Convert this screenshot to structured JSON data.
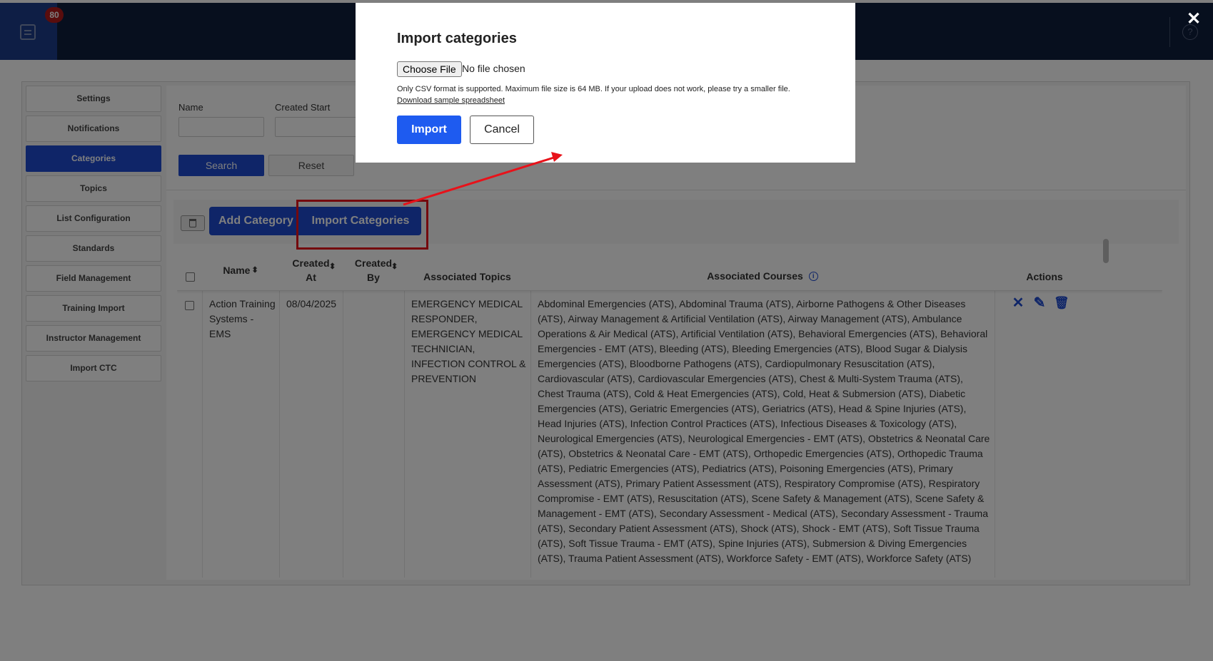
{
  "topbar": {
    "badge_count": "80",
    "help_icon": "question-circle-icon"
  },
  "sidebar": {
    "items": [
      {
        "label": "Settings",
        "active": false
      },
      {
        "label": "Notifications",
        "active": false
      },
      {
        "label": "Categories",
        "active": true
      },
      {
        "label": "Topics",
        "active": false
      },
      {
        "label": "List Configuration",
        "active": false
      },
      {
        "label": "Standards",
        "active": false
      },
      {
        "label": "Field Management",
        "active": false
      },
      {
        "label": "Training Import",
        "active": false
      },
      {
        "label": "Instructor Management",
        "active": false
      },
      {
        "label": "Import CTC",
        "active": false
      }
    ]
  },
  "filters": {
    "name_label": "Name",
    "created_start_label": "Created Start",
    "name_value": "",
    "created_start_value": "",
    "search_label": "Search",
    "reset_label": "Reset"
  },
  "toolbar": {
    "add_label": "Add Category",
    "import_label": "Import Categories"
  },
  "table": {
    "headers": {
      "name": "Name",
      "created_at": "Created At",
      "created_by": "Created By",
      "associated_topics": "Associated Topics",
      "associated_courses": "Associated Courses",
      "actions": "Actions"
    },
    "rows": [
      {
        "name": "Action Training Systems - EMS",
        "created_at": "08/04/2025",
        "created_by": "",
        "associated_topics": "EMERGENCY MEDICAL RESPONDER, EMERGENCY MEDICAL TECHNICIAN, INFECTION CONTROL & PREVENTION",
        "associated_courses": "Abdominal Emergencies (ATS), Abdominal Trauma (ATS), Airborne Pathogens & Other Diseases (ATS), Airway Management & Artificial Ventilation (ATS), Airway Management (ATS), Ambulance Operations & Air Medical (ATS), Artificial Ventilation (ATS), Behavioral Emergencies (ATS), Behavioral Emergencies - EMT (ATS), Bleeding (ATS), Bleeding Emergencies (ATS), Blood Sugar & Dialysis Emergencies (ATS), Bloodborne Pathogens (ATS), Cardiopulmonary Resuscitation (ATS), Cardiovascular (ATS), Cardiovascular Emergencies (ATS), Chest & Multi-System Trauma (ATS), Chest Trauma (ATS), Cold & Heat Emergencies (ATS), Cold, Heat & Submersion (ATS), Diabetic Emergencies (ATS), Geriatric Emergencies (ATS), Geriatrics (ATS), Head & Spine Injuries (ATS), Head Injuries (ATS), Infection Control Practices (ATS), Infectious Diseases & Toxicology (ATS), Neurological Emergencies (ATS), Neurological Emergencies - EMT (ATS), Obstetrics & Neonatal Care (ATS), Obstetrics & Neonatal Care - EMT (ATS), Orthopedic Emergencies (ATS), Orthopedic Trauma (ATS), Pediatric Emergencies (ATS), Pediatrics (ATS), Poisoning Emergencies (ATS), Primary Assessment (ATS), Primary Patient Assessment (ATS), Respiratory Compromise (ATS), Respiratory Compromise - EMT (ATS), Resuscitation (ATS), Scene Safety & Management (ATS), Scene Safety & Management - EMT (ATS), Secondary Assessment - Medical (ATS), Secondary Assessment - Trauma (ATS), Secondary Patient Assessment (ATS), Shock (ATS), Shock - EMT (ATS), Soft Tissue Trauma (ATS), Soft Tissue Trauma - EMT (ATS), Spine Injuries (ATS), Submersion & Diving Emergencies (ATS), Trauma Patient Assessment (ATS), Workforce Safety - EMT (ATS), Workforce Safety (ATS)"
      }
    ]
  },
  "modal": {
    "title": "Import categories",
    "choose_file_label": "Choose File",
    "file_status": "No file chosen",
    "note": "Only CSV format is supported. Maximum file size is 64 MB. If your upload does not work, please try a smaller file.",
    "sample_link": "Download sample spreadsheet",
    "import_label": "Import",
    "cancel_label": "Cancel"
  },
  "annotation": {
    "color": "#e8121a"
  },
  "colors": {
    "brand": "#1e4bd0",
    "topbar": "#0f1e3d"
  }
}
